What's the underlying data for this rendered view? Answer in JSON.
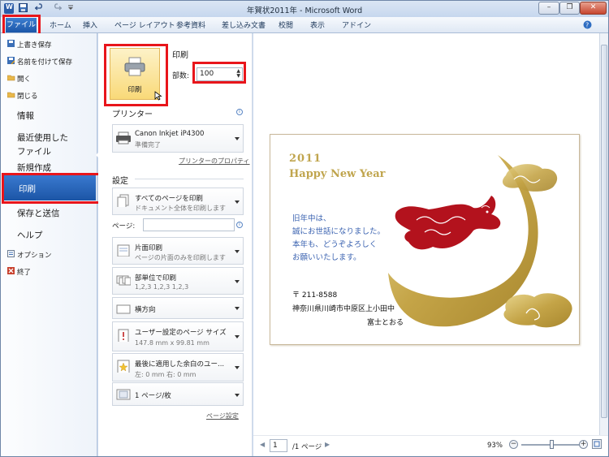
{
  "window": {
    "title": "年賀状2011年 - Microsoft Word",
    "qat_icons": [
      "word-app-icon",
      "save-icon",
      "undo-icon",
      "redo-icon"
    ],
    "buttons": {
      "minimize": "–",
      "restore": "❐",
      "close": "✕"
    }
  },
  "ribbon": {
    "tabs": [
      "ファイル",
      "ホーム",
      "挿入",
      "ページ レイアウト",
      "参考資料",
      "差し込み文書",
      "校閲",
      "表示",
      "アドイン"
    ]
  },
  "backstage_menu": {
    "quick": [
      "上書き保存",
      "名前を付けて保存",
      "開く",
      "閉じる"
    ],
    "sections": {
      "info": "情報",
      "recent_line1": "最近使用した",
      "recent_line2": "ファイル",
      "new": "新規作成",
      "print": "印刷",
      "save_send": "保存と送信",
      "help": "ヘルプ"
    },
    "bottom": [
      "オプション",
      "終了"
    ]
  },
  "print_panel": {
    "heading": "印刷",
    "print_button": "印刷",
    "copies_label": "部数:",
    "copies_value": "100",
    "printer_heading": "プリンター",
    "printer_name": "Canon Inkjet iP4300",
    "printer_status": "準備完了",
    "printer_properties": "プリンターのプロパティ",
    "settings_heading": "設定",
    "pages_label": "ページ:",
    "pages_value": "",
    "options": [
      {
        "main": "すべてのページを印刷",
        "sub": "ドキュメント全体を印刷します"
      },
      {
        "main": "片面印刷",
        "sub": "ページの片面のみを印刷します"
      },
      {
        "main": "部単位で印刷",
        "sub": "1,2,3    1,2,3    1,2,3"
      },
      {
        "main": "横方向",
        "sub": ""
      },
      {
        "main": "ユーザー設定のページ サイズ",
        "sub": "147.8 mm x 99.81 mm"
      },
      {
        "main": "最後に適用した余白のユー...",
        "sub": "左:  0 mm    右:  0 mm"
      },
      {
        "main": "1 ページ/枚",
        "sub": ""
      }
    ],
    "page_setup_link": "ページ設定"
  },
  "preview": {
    "year": "2011",
    "greeting": "Happy New Year",
    "message": [
      "旧年中は、",
      "誠にお世話になりました。",
      "本年も、どうぞよろしく",
      "お願いいたします。"
    ],
    "postal": "〒 211-8588",
    "address": "神奈川県川崎市中原区上小田中",
    "name": "富士とおる",
    "colors": {
      "gold": "#c0a54e",
      "red": "#b3121d",
      "blue": "#3a62b0"
    }
  },
  "status": {
    "current_page": "1",
    "total_pages": "/1 ページ",
    "zoom": "93%",
    "zoom_level_fraction": 0.52
  }
}
